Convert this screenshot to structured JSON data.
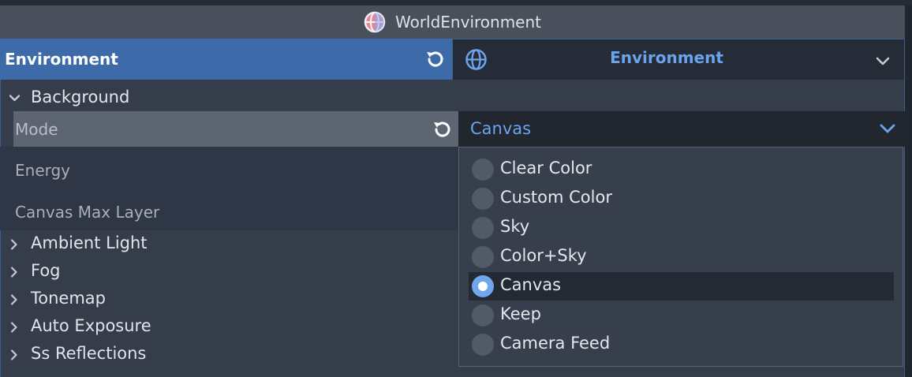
{
  "title_bar": {
    "node_name": "WorldEnvironment",
    "icon": "world-environment-icon"
  },
  "property": {
    "label": "Environment",
    "value": "Environment",
    "revert_icon": "revert-icon",
    "resource_icon": "globe-icon",
    "dropdown_icon": "chevron-down-icon"
  },
  "background_section": {
    "title": "Background",
    "mode": {
      "label": "Mode",
      "value": "Canvas"
    },
    "energy": {
      "label": "Energy"
    },
    "canvas_max_layer": {
      "label": "Canvas Max Layer"
    }
  },
  "sections": [
    "Ambient Light",
    "Fog",
    "Tonemap",
    "Auto Exposure",
    "Ss Reflections"
  ],
  "mode_options": [
    {
      "label": "Clear Color",
      "selected": false
    },
    {
      "label": "Custom Color",
      "selected": false
    },
    {
      "label": "Sky",
      "selected": false
    },
    {
      "label": "Color+Sky",
      "selected": false
    },
    {
      "label": "Canvas",
      "selected": true
    },
    {
      "label": "Keep",
      "selected": false
    },
    {
      "label": "Camera Feed",
      "selected": false
    }
  ],
  "colors": {
    "accent_blue": "#69a4ec",
    "header_blue": "#3d6aa8",
    "panel_bg": "#363d4a"
  }
}
